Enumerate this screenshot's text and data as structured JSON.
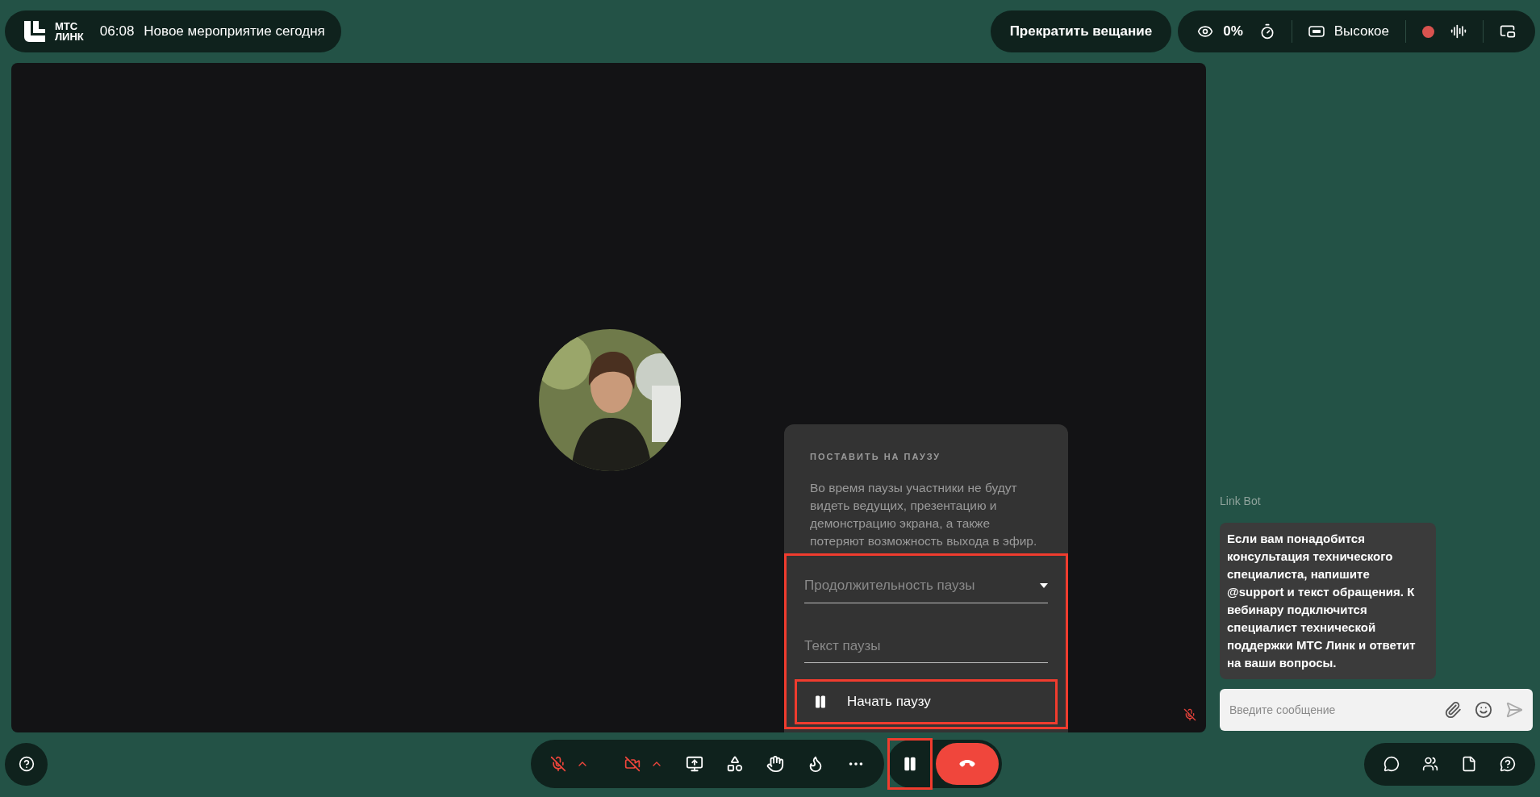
{
  "header": {
    "logo_lines": [
      "МТС",
      "ЛИНК"
    ],
    "time": "06:08",
    "title": "Новое мероприятие сегодня"
  },
  "stop_button": "Прекратить вещание",
  "stats": {
    "viewers": "0%",
    "quality": "Высокое",
    "recording": true
  },
  "video": {
    "mic_muted": true
  },
  "pause_popup": {
    "title": "ПОСТАВИТЬ НА ПАУЗУ",
    "description": "Во время паузы участники не будут видеть ведущих, презентацию и демонстрацию экрана, а также потеряют возможность выхода в эфир.",
    "fields_highlighted": true,
    "fields": [
      {
        "kind": "select",
        "placeholder": "Продолжительность паузы"
      },
      {
        "kind": "text",
        "placeholder": "Текст паузы"
      }
    ],
    "start_button": {
      "label": "Начать паузу",
      "highlighted": true
    }
  },
  "chat": {
    "sender": "Link Bot",
    "message": "Если вам понадобится консультация технического специалиста, напишите @support и текст обращения. К вебинару подключится специалист технической поддержки МТС Линк и ответит на ваши вопросы.",
    "input_placeholder": "Введите сообщение"
  },
  "toolbar": {
    "mic_muted": true,
    "camera_off": true,
    "pause_highlighted": true
  }
}
